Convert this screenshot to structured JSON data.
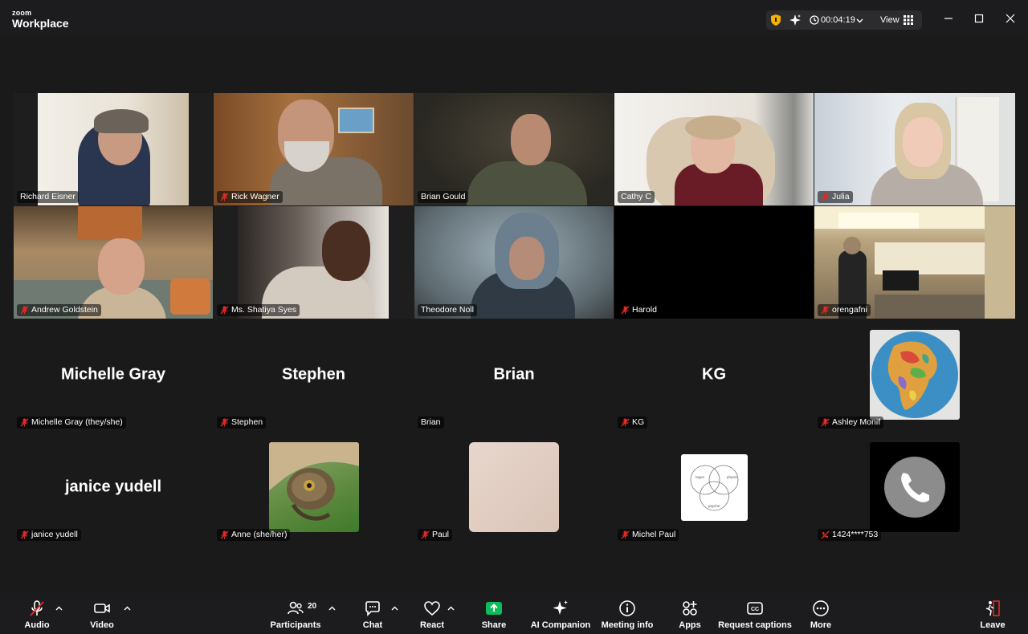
{
  "app": {
    "brand_small": "zoom",
    "brand_name": "Workplace"
  },
  "header": {
    "timer": "00:04:19",
    "view_label": "View"
  },
  "colors": {
    "active_speaker": "#3cd27a",
    "share": "#0dbd5b",
    "leave": "#e02828",
    "muted": "#e02828"
  },
  "tiles": {
    "t1": "Richard Eisner",
    "t2": "Rick Wagner",
    "t3": "Brian Gould",
    "t4": "Cathy C",
    "t5": "Julia",
    "t6": "Andrew Goldstein",
    "t7": "Ms. Shatiya Syes",
    "t8": "Theodore Noll",
    "t9": "Harold",
    "t10": "orengafni",
    "t11": {
      "big": "Michelle Gray",
      "label": "Michelle Gray (they/she)"
    },
    "t12": {
      "big": "Stephen",
      "label": "Stephen"
    },
    "t13": {
      "big": "Brian",
      "label": "Brian"
    },
    "t14": {
      "big": "KG",
      "label": "KG"
    },
    "t15": "Ashley Monif",
    "t16": {
      "big": "janice yudell",
      "label": "janice yudell"
    },
    "t17": "Anne (she/her)",
    "t18": "Paul",
    "t19": "Michel Paul",
    "t20": "1424****753"
  },
  "venn": {
    "a": "logos",
    "b": "physis",
    "c": "psyche"
  },
  "toolbar": {
    "audio": "Audio",
    "video": "Video",
    "participants": "Participants",
    "participants_count": "20",
    "chat": "Chat",
    "react": "React",
    "share": "Share",
    "ai": "AI Companion",
    "info": "Meeting info",
    "apps": "Apps",
    "captions": "Request captions",
    "more": "More",
    "leave": "Leave"
  }
}
